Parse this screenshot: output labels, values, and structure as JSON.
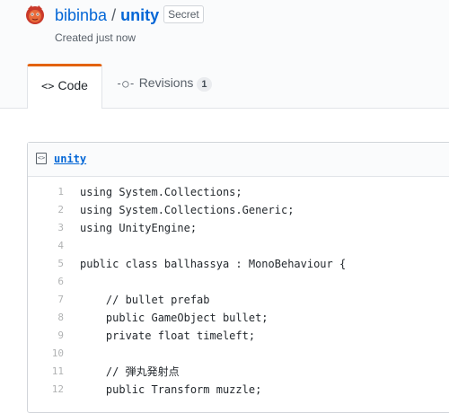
{
  "gist": {
    "owner": "bibinba",
    "separator": "/",
    "name": "unity",
    "visibility": "Secret",
    "created": "Created just now"
  },
  "tabs": [
    {
      "label": "Code",
      "icon": "code-icon"
    },
    {
      "label": "Revisions",
      "icon": "commit-icon",
      "count": "1"
    }
  ],
  "file": {
    "name": "unity",
    "icon": "file-code-icon",
    "lines": [
      {
        "num": "1",
        "text": "using System.Collections;"
      },
      {
        "num": "2",
        "text": "using System.Collections.Generic;"
      },
      {
        "num": "3",
        "text": "using UnityEngine;"
      },
      {
        "num": "4",
        "text": ""
      },
      {
        "num": "5",
        "text": "public class ballhassya : MonoBehaviour {"
      },
      {
        "num": "6",
        "text": ""
      },
      {
        "num": "7",
        "text": "    // bullet prefab"
      },
      {
        "num": "8",
        "text": "    public GameObject bullet;"
      },
      {
        "num": "9",
        "text": "    private float timeleft;"
      },
      {
        "num": "10",
        "text": ""
      },
      {
        "num": "11",
        "text": "    // 弾丸発射点"
      },
      {
        "num": "12",
        "text": "    public Transform muzzle;"
      }
    ]
  },
  "colors": {
    "link": "#0366d6",
    "active_tab_accent": "#e36209",
    "header_bg": "#fafbfc"
  }
}
